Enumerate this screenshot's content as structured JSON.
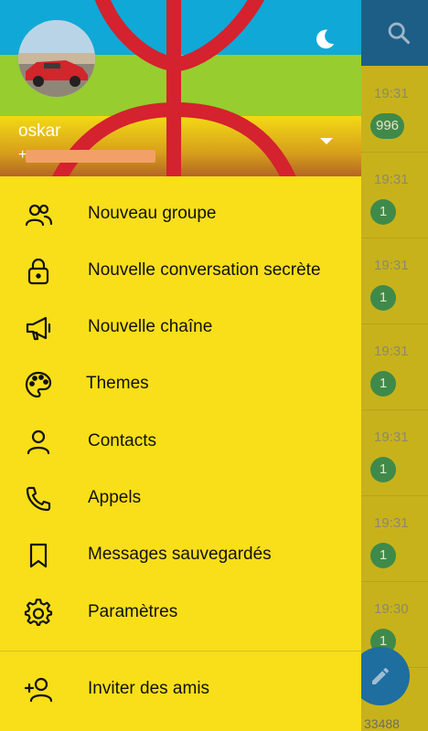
{
  "chat_list": {
    "rows": [
      {
        "time": "19:31",
        "badge": "996"
      },
      {
        "time": "19:31",
        "badge": "1"
      },
      {
        "time": "19:31",
        "badge": "1"
      },
      {
        "time": "19:31",
        "badge": "1"
      },
      {
        "time": "19:31",
        "badge": "1"
      },
      {
        "time": "19:31",
        "badge": "1"
      },
      {
        "time": "19:30",
        "badge": "1"
      }
    ],
    "bottom_count": "33488"
  },
  "drawer": {
    "user_name": "oskar",
    "user_phone": "+",
    "menu": [
      {
        "label": "Nouveau groupe",
        "icon": "group-icon"
      },
      {
        "label": "Nouvelle conversation secrète",
        "icon": "lock-icon"
      },
      {
        "label": "Nouvelle chaîne",
        "icon": "megaphone-icon"
      },
      {
        "label": "Themes",
        "icon": "palette-icon"
      },
      {
        "label": "Contacts",
        "icon": "person-icon"
      },
      {
        "label": "Appels",
        "icon": "phone-icon"
      },
      {
        "label": "Messages sauvegardés",
        "icon": "bookmark-icon"
      },
      {
        "label": "Paramètres",
        "icon": "gear-icon"
      },
      {
        "label": "Inviter des amis",
        "icon": "add-person-icon"
      }
    ]
  },
  "colors": {
    "drawer_bg": "#f8df19",
    "header_blue": "#10a8d6",
    "header_green": "#97cd2e",
    "emblem_red": "#d4222e",
    "appbar": "#1d5e86",
    "fab": "#1f6ea0"
  }
}
